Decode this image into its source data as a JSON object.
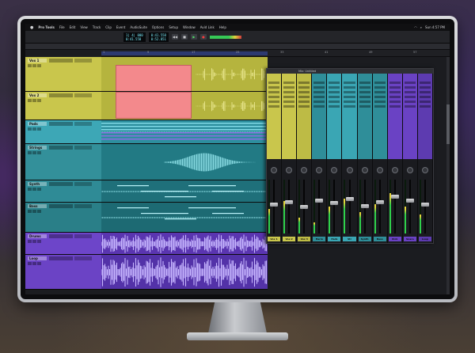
{
  "menubar": {
    "app_name": "Pro Tools",
    "items": [
      "File",
      "Edit",
      "View",
      "Track",
      "Clip",
      "Event",
      "AudioSuite",
      "Options",
      "Setup",
      "Window",
      "Avid Link",
      "Help"
    ],
    "clock": "Sun 4:57 PM"
  },
  "transport": {
    "main_counter": "1| 4| 000",
    "sub_counter": "0:41.558",
    "start": "0:41.558",
    "end": "0:52.851",
    "length": "0:11.293"
  },
  "timeline": {
    "ticks": [
      "1",
      "9",
      "17",
      "25",
      "33",
      "41",
      "49",
      "57"
    ]
  },
  "tracks": [
    {
      "name": "Vox 1",
      "color": "#c9c64c",
      "lane": "#b5b43e"
    },
    {
      "name": "Vox 2",
      "color": "#c9c64c",
      "lane": "#b5b43e"
    },
    {
      "name": "Pads",
      "color": "#3da7b6",
      "lane": "#2d8f9e"
    },
    {
      "name": "Strings",
      "color": "#33909a",
      "lane": "#227a84"
    },
    {
      "name": "Synth",
      "color": "#2f8b96",
      "lane": "#1f707a"
    },
    {
      "name": "Bass",
      "color": "#2a7f88",
      "lane": "#1d6a73"
    },
    {
      "name": "Drums",
      "color": "#6d45c9",
      "lane": "#5a35b0"
    },
    {
      "name": "Loop",
      "color": "#6b43c5",
      "lane": "#5332a8"
    }
  ],
  "mixer": {
    "title": "Mix: Untitled",
    "strips": [
      {
        "name": "Vox 1",
        "color": "#c9c64c",
        "fader": 0.55,
        "level": 0.45
      },
      {
        "name": "Vox 2",
        "color": "#c9c64c",
        "fader": 0.6,
        "level": 0.6
      },
      {
        "name": "Vox 3",
        "color": "#bdbb45",
        "fader": 0.5,
        "level": 0.3
      },
      {
        "name": "Harm",
        "color": "#2f8e99",
        "fader": 0.62,
        "level": 0.2
      },
      {
        "name": "Pads",
        "color": "#3aa6b4",
        "fader": 0.58,
        "level": 0.5
      },
      {
        "name": "Str",
        "color": "#3aa6b4",
        "fader": 0.66,
        "level": 0.65
      },
      {
        "name": "Synth",
        "color": "#2f8e99",
        "fader": 0.52,
        "level": 0.4
      },
      {
        "name": "Bass",
        "color": "#2f8e99",
        "fader": 0.6,
        "level": 0.55
      },
      {
        "name": "Kick",
        "color": "#6a42c4",
        "fader": 0.7,
        "level": 0.75
      },
      {
        "name": "Snare",
        "color": "#6a42c4",
        "fader": 0.63,
        "level": 0.5
      },
      {
        "name": "Loop",
        "color": "#5d3bb0",
        "fader": 0.55,
        "level": 0.35
      }
    ]
  }
}
